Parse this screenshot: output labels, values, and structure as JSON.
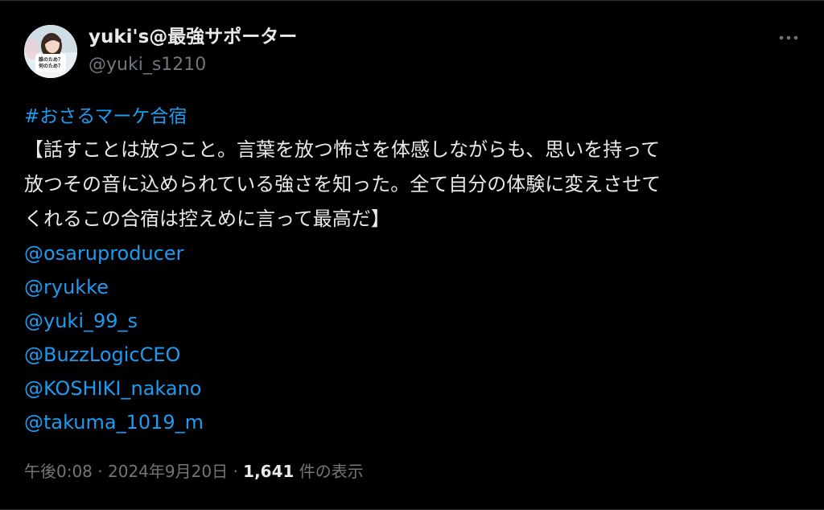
{
  "author": {
    "display_name": "yuki's@最強サポーター",
    "handle": "@yuki_s1210",
    "avatar_text_1": "誰のため？",
    "avatar_text_2": "何のため？"
  },
  "tweet": {
    "hashtag": "#おさるマーケ合宿",
    "text_lines": [
      "【話すことは放つこと。言葉を放つ怖さを体感しながらも、思いを持って",
      "放つその音に込められている強さを知った。全て自分の体験に変えさせて",
      "くれるこの合宿は控えめに言って最高だ】"
    ],
    "mentions": [
      "@osaruproducer",
      "@ryukke",
      "@yuki_99_s",
      "@BuzzLogicCEO",
      "@KOSHIKI_nakano",
      "@takuma_1019_m"
    ]
  },
  "meta": {
    "time": "午後0:08",
    "separator": "·",
    "date": "2024年9月20日",
    "views_count": "1,641",
    "views_label": "件の表示"
  },
  "colors": {
    "background": "#000000",
    "text": "#e7e9ea",
    "secondary": "#71767b",
    "link": "#1d9bf0"
  },
  "icons": {
    "more": "more-horizontal-icon"
  }
}
